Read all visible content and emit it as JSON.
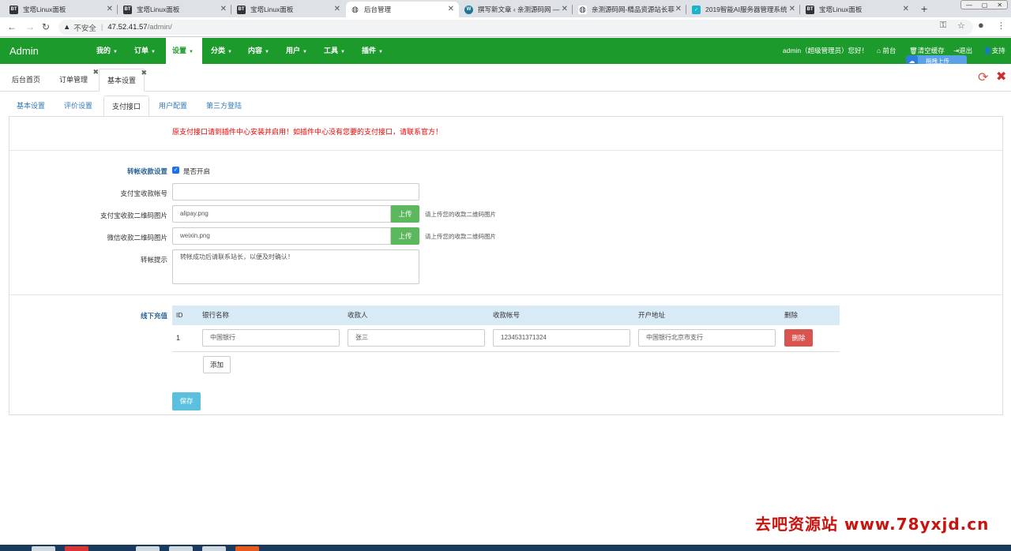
{
  "browser": {
    "tabs": [
      {
        "label": "宝塔Linux面板",
        "icon": "BT"
      },
      {
        "label": "宝塔Linux面板",
        "icon": "BT"
      },
      {
        "label": "宝塔Linux面板",
        "icon": "BT"
      },
      {
        "label": "后台管理",
        "icon": "globe"
      },
      {
        "label": "撰写新文章 ‹ 亲测源码网 —",
        "icon": "W"
      },
      {
        "label": "亲测源码网-精品资源站长菲",
        "icon": "globe"
      },
      {
        "label": "2019智能AI服务器管理系统",
        "icon": "check"
      },
      {
        "label": "宝塔Linux面板",
        "icon": "BT"
      }
    ],
    "security_label": "不安全",
    "url_host": "47.52.41.57",
    "url_path": "/admin/"
  },
  "navbar": {
    "brand": "Admin",
    "menu": [
      "我的",
      "订单",
      "设置",
      "分类",
      "内容",
      "用户",
      "工具",
      "插件"
    ],
    "greeting": "admin（超级管理员）您好！",
    "frontend": "前台",
    "clear_cache": "清空缓存",
    "logout": "退出",
    "support": "支持",
    "drag_upload": "拖拽上传"
  },
  "page_tabs": [
    "后台首页",
    "订单管理",
    "基本设置"
  ],
  "settings_tabs": [
    "基本设置",
    "评价设置",
    "支付接口",
    "用户配置",
    "第三方登陆"
  ],
  "notice": "原支付接口请到插件中心安装并启用！如插件中心没有您要的支付接口，请联系官方！",
  "form": {
    "transfer_label": "转帐收款设置",
    "enable_label": "是否开启",
    "alipay_account_label": "支付宝收款帐号",
    "alipay_account_value": "",
    "alipay_qr_label": "支付宝收款二维码图片",
    "alipay_qr_value": "alipay.png",
    "wechat_qr_label": "微信收款二维码图片",
    "wechat_qr_value": "weixin.png",
    "upload_label": "上传",
    "upload_help": "请上传您的收款二维码图片",
    "tip_label": "转帐提示",
    "tip_value": "转帐成功后请联系站长，以便及时确认！"
  },
  "offline": {
    "label": "线下充值",
    "headers": [
      "ID",
      "银行名称",
      "收款人",
      "收款帐号",
      "开户地址",
      "删除"
    ],
    "rows": [
      {
        "id": "1",
        "bank": "中国银行",
        "payee": "张三",
        "account": "1234531371324",
        "address": "中国银行北京市支行",
        "delete": "删除"
      }
    ],
    "add_label": "添加"
  },
  "save_label": "保存",
  "watermark": "去吧资源站 www.78yxjd.cn",
  "colors": {
    "navbar": "#1c9b2c",
    "danger": "#d9534f",
    "success": "#5cb85c",
    "info": "#5bc0de"
  }
}
